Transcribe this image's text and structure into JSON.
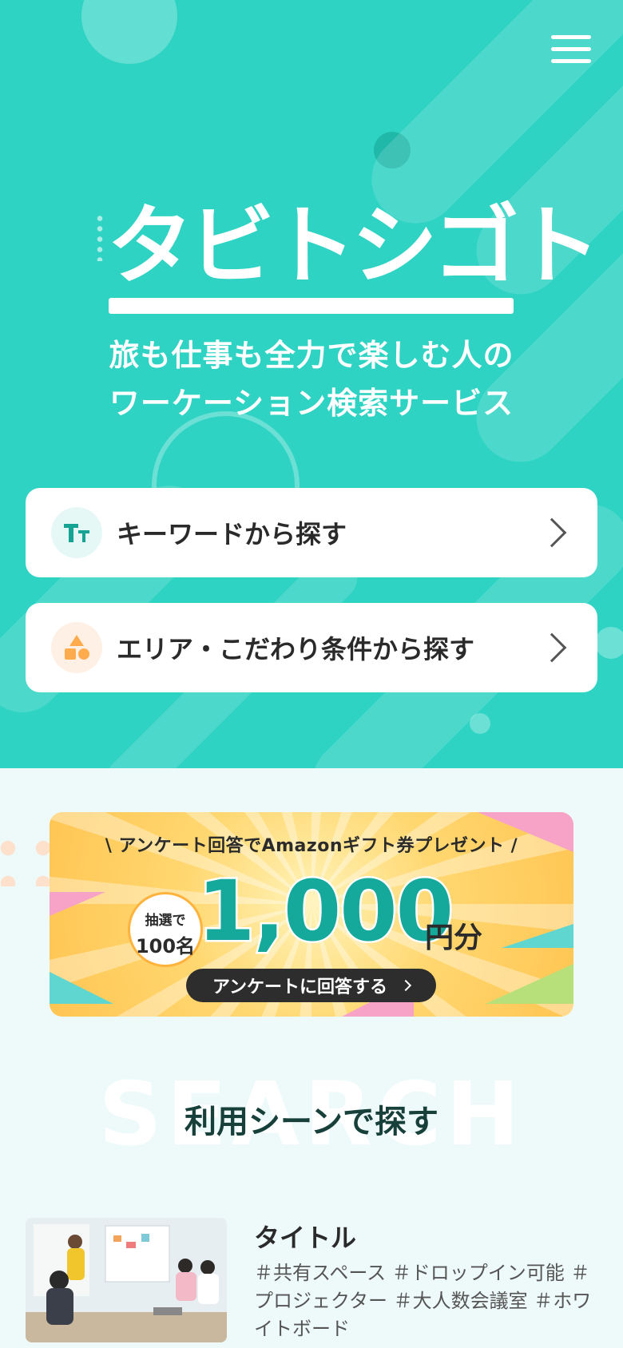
{
  "header": {
    "logo_text": "タビトシゴト",
    "menu_icon": "hamburger-menu-icon"
  },
  "hero": {
    "tagline_line1": "旅も仕事も全力で楽しむ人の",
    "tagline_line2": "ワーケーション検索サービス",
    "buttons": [
      {
        "label": "キーワードから探す",
        "icon": "text-size-icon"
      },
      {
        "label": "エリア・こだわり条件から探す",
        "icon": "shapes-icon"
      }
    ],
    "colors": {
      "background": "#2fd3c3",
      "accent_dark": "#14a99a"
    }
  },
  "banner": {
    "headline": "\\ アンケート回答でAmazonギフト券プレゼント /",
    "badge_line1": "抽選で",
    "badge_line2": "100名",
    "amount": "1,000",
    "unit": "円分",
    "button_label": "アンケートに回答する"
  },
  "section": {
    "watermark": "SEARCH",
    "title": "利用シーンで探す"
  },
  "scenes": [
    {
      "title": "タイトル",
      "tags": "＃共有スペース ＃ドロップイン可能 ＃プロジェクター ＃大人数会議室 ＃ホワイトボード"
    }
  ]
}
